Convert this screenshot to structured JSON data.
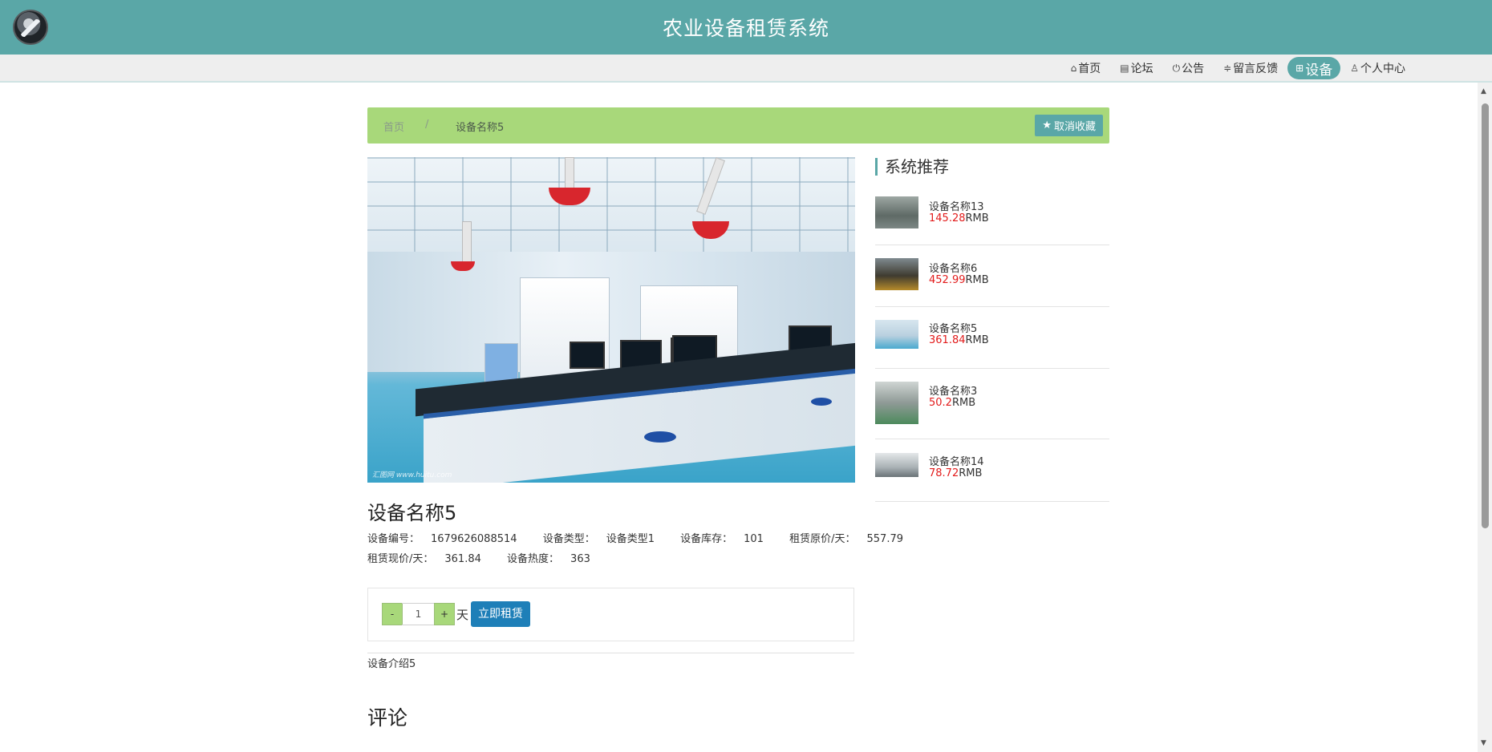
{
  "header": {
    "title": "农业设备租赁系统"
  },
  "nav": [
    {
      "label": "首页",
      "icon": "home-icon"
    },
    {
      "label": "论坛",
      "icon": "document-icon"
    },
    {
      "label": "公告",
      "icon": "power-icon"
    },
    {
      "label": "留言反馈",
      "icon": "sliders-icon"
    },
    {
      "label": "设备",
      "icon": "grid-icon",
      "active": true
    },
    {
      "label": "个人中心",
      "icon": "user-icon"
    }
  ],
  "breadcrumb": {
    "home": "首页",
    "separator": "/",
    "current": "设备名称5"
  },
  "favorite_button": {
    "label": "取消收藏"
  },
  "image": {
    "watermark": "汇图网 www.huitu.com"
  },
  "device": {
    "name": "设备名称5",
    "meta": {
      "code_label": "设备编号：",
      "code": "1679626088514",
      "type_label": "设备类型：",
      "type": "设备类型1",
      "stock_label": "设备库存：",
      "stock": "101",
      "orig_price_label": "租赁原价/天：",
      "orig_price": "557.79",
      "cur_price_label": "租赁现价/天：",
      "cur_price": "361.84",
      "heat_label": "设备热度：",
      "heat": "363"
    },
    "intro": "设备介绍5"
  },
  "rent": {
    "minus": "-",
    "plus": "+",
    "quantity": "1",
    "unit": "天",
    "button": "立即租赁"
  },
  "comments": {
    "title": "评论"
  },
  "recommend": {
    "title": "系统推荐",
    "currency": "RMB",
    "items": [
      {
        "name": "设备名称13",
        "price": "145.28"
      },
      {
        "name": "设备名称6",
        "price": "452.99"
      },
      {
        "name": "设备名称5",
        "price": "361.84"
      },
      {
        "name": "设备名称3",
        "price": "50.2"
      },
      {
        "name": "设备名称14",
        "price": "78.72"
      }
    ]
  },
  "colors": {
    "accent": "#5aa7a7",
    "breadcrumb_bg": "#a8d87a",
    "price": "#e21a1a",
    "rent_button": "#1e7fb8"
  }
}
